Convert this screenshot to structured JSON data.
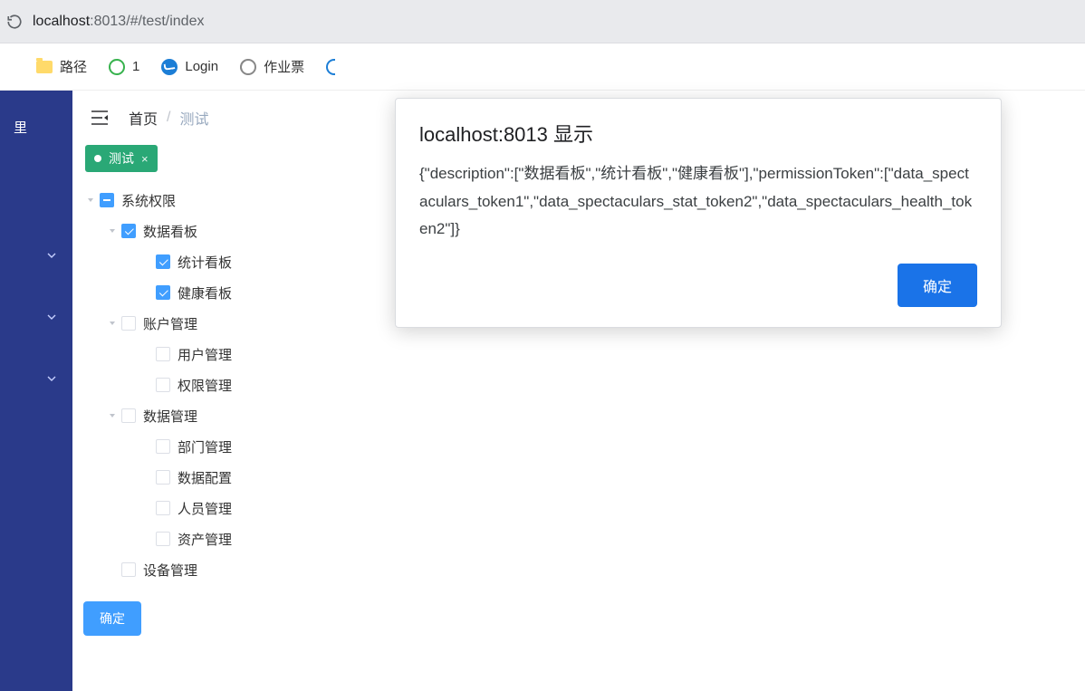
{
  "browser": {
    "url_host": "localhost",
    "url_port_path": ":8013/#/test/index"
  },
  "bookmarks": {
    "path_label": "路径",
    "one_label": "1",
    "login_label": "Login",
    "ticket_label": "作业票"
  },
  "sidebar": {
    "item0_clip": "里"
  },
  "breadcrumb": {
    "home": "首页",
    "sep": "/",
    "current": "测试"
  },
  "tab": {
    "label": "测试",
    "close": "×"
  },
  "tree": {
    "n0": "系统权限",
    "n0_0": "数据看板",
    "n0_0_0": "统计看板",
    "n0_0_1": "健康看板",
    "n0_1": "账户管理",
    "n0_1_0": "用户管理",
    "n0_1_1": "权限管理",
    "n0_2": "数据管理",
    "n0_2_0": "部门管理",
    "n0_2_1": "数据配置",
    "n0_2_2": "人员管理",
    "n0_2_3": "资产管理",
    "n0_3": "设备管理"
  },
  "buttons": {
    "confirm": "确定"
  },
  "dialog": {
    "title": "localhost:8013 显示",
    "body": "{\"description\":[\"数据看板\",\"统计看板\",\"健康看板\"],\"permissionToken\":[\"data_spectaculars_token1\",\"data_spectaculars_stat_token2\",\"data_spectaculars_health_token2\"]}",
    "ok": "确定"
  }
}
